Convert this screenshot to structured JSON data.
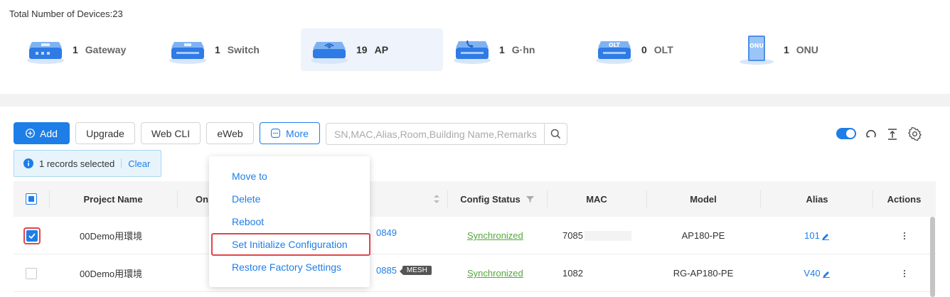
{
  "summary": {
    "total_label": "Total Number of Devices:23"
  },
  "device_types": [
    {
      "count": "1",
      "name": "Gateway",
      "icon": "gateway-icon"
    },
    {
      "count": "1",
      "name": "Switch",
      "icon": "switch-icon"
    },
    {
      "count": "19",
      "name": "AP",
      "icon": "ap-icon",
      "active": true
    },
    {
      "count": "1",
      "name": "G·hn",
      "icon": "ghn-icon"
    },
    {
      "count": "0",
      "name": "OLT",
      "icon": "olt-icon",
      "badge": "OLT"
    },
    {
      "count": "1",
      "name": "ONU",
      "icon": "onu-icon",
      "badge": "ONU"
    }
  ],
  "toolbar": {
    "add_label": "Add",
    "upgrade_label": "Upgrade",
    "webcli_label": "Web CLI",
    "eweb_label": "eWeb",
    "more_label": "More",
    "search_placeholder": "SN,MAC,Alias,Room,Building Name,Remarks"
  },
  "selection": {
    "text": "1 records selected",
    "clear_label": "Clear"
  },
  "table": {
    "headers": {
      "project": "Project Name",
      "online": "On",
      "config_status": "Config Status",
      "mac": "MAC",
      "model": "Model",
      "alias": "Alias",
      "actions": "Actions"
    },
    "rows": [
      {
        "project": "00Demo用環境",
        "sn": "0849",
        "config_status": "Synchronized",
        "mac": "7085",
        "model": "AP180-PE",
        "alias": "101",
        "checked": true,
        "mesh": ""
      },
      {
        "project": "00Demo用環境",
        "sn": "0885",
        "config_status": "Synchronized",
        "mac": "1082",
        "model": "RG-AP180-PE",
        "alias": "V40",
        "checked": false,
        "mesh": "MESH"
      }
    ]
  },
  "more_menu": {
    "items": [
      "Move to",
      "Delete",
      "Reboot",
      "Set Initialize Configuration",
      "Restore Factory Settings"
    ],
    "highlighted": "Set Initialize Configuration"
  },
  "colors": {
    "accent": "#1e7ee8",
    "success": "#52a83b",
    "highlight_border": "#e0464a"
  }
}
